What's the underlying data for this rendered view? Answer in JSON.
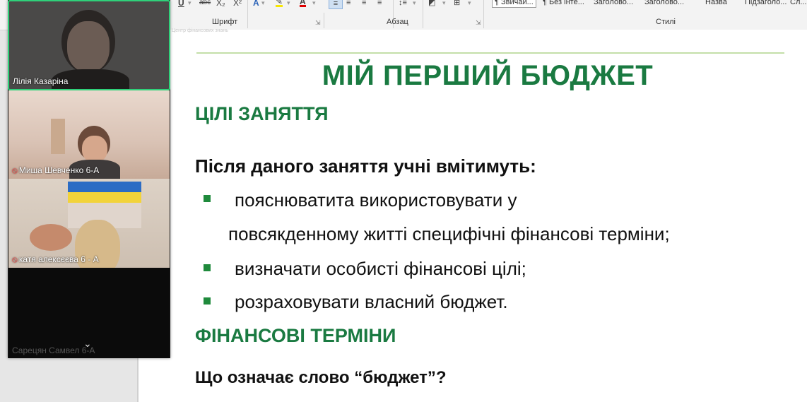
{
  "ribbon": {
    "groups": {
      "font": "Шрифт",
      "paragraph": "Абзац",
      "styles": "Стилі"
    },
    "font_buttons": {
      "underline": "U",
      "strikethrough": "abc",
      "subscript": "X₂",
      "superscript": "X²"
    },
    "styles": [
      "¶ Звичай...",
      "¶ Без інте...",
      "Заголово...",
      "Заголово...",
      "Назва",
      "Підзаголо...",
      "Сл..."
    ]
  },
  "document": {
    "watermark": "Центр фінансових знань",
    "title": "МІЙ ПЕРШИЙ БЮДЖЕТ",
    "section_goals": "ЦІЛІ ЗАНЯТТЯ",
    "lead": "Після даного заняття учні вмітимуть:",
    "bullets": [
      {
        "line1": "пояснюватита  використовувати    у",
        "line2": "повсякденному житті специфічні фінансові терміни;"
      },
      {
        "line1": "визначати особисті фінансові цілі;"
      },
      {
        "line1": "розраховувати власний бюджет."
      }
    ],
    "section_terms": "ФІНАНСОВІ ТЕРМІНИ",
    "question": "Що означає слово “бюджет”?"
  },
  "video": {
    "participants": [
      {
        "name": "Лілія Казаріна",
        "muted": false
      },
      {
        "name": "Миша Шевченко 6-А",
        "muted": true
      },
      {
        "name": "катя алексєєва 6 - А",
        "muted": true
      },
      {
        "name": "Сарецян Самвел 6-А",
        "muted": false
      }
    ]
  },
  "colors": {
    "heading_green": "#1a7a41",
    "bullet_green": "#1f8a3c",
    "active_speaker": "#2fd17a"
  }
}
